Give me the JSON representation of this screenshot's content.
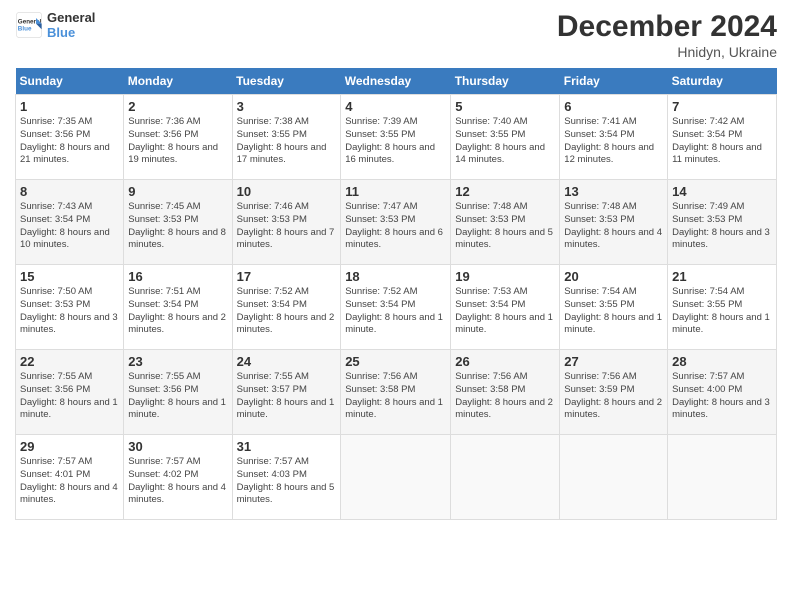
{
  "header": {
    "logo_general": "General",
    "logo_blue": "Blue",
    "month": "December 2024",
    "location": "Hnidyn, Ukraine"
  },
  "days_of_week": [
    "Sunday",
    "Monday",
    "Tuesday",
    "Wednesday",
    "Thursday",
    "Friday",
    "Saturday"
  ],
  "weeks": [
    [
      {
        "day": "1",
        "sunrise": "7:35 AM",
        "sunset": "3:56 PM",
        "daylight": "8 hours and 21 minutes."
      },
      {
        "day": "2",
        "sunrise": "7:36 AM",
        "sunset": "3:56 PM",
        "daylight": "8 hours and 19 minutes."
      },
      {
        "day": "3",
        "sunrise": "7:38 AM",
        "sunset": "3:55 PM",
        "daylight": "8 hours and 17 minutes."
      },
      {
        "day": "4",
        "sunrise": "7:39 AM",
        "sunset": "3:55 PM",
        "daylight": "8 hours and 16 minutes."
      },
      {
        "day": "5",
        "sunrise": "7:40 AM",
        "sunset": "3:55 PM",
        "daylight": "8 hours and 14 minutes."
      },
      {
        "day": "6",
        "sunrise": "7:41 AM",
        "sunset": "3:54 PM",
        "daylight": "8 hours and 12 minutes."
      },
      {
        "day": "7",
        "sunrise": "7:42 AM",
        "sunset": "3:54 PM",
        "daylight": "8 hours and 11 minutes."
      }
    ],
    [
      {
        "day": "8",
        "sunrise": "7:43 AM",
        "sunset": "3:54 PM",
        "daylight": "8 hours and 10 minutes."
      },
      {
        "day": "9",
        "sunrise": "7:45 AM",
        "sunset": "3:53 PM",
        "daylight": "8 hours and 8 minutes."
      },
      {
        "day": "10",
        "sunrise": "7:46 AM",
        "sunset": "3:53 PM",
        "daylight": "8 hours and 7 minutes."
      },
      {
        "day": "11",
        "sunrise": "7:47 AM",
        "sunset": "3:53 PM",
        "daylight": "8 hours and 6 minutes."
      },
      {
        "day": "12",
        "sunrise": "7:48 AM",
        "sunset": "3:53 PM",
        "daylight": "8 hours and 5 minutes."
      },
      {
        "day": "13",
        "sunrise": "7:48 AM",
        "sunset": "3:53 PM",
        "daylight": "8 hours and 4 minutes."
      },
      {
        "day": "14",
        "sunrise": "7:49 AM",
        "sunset": "3:53 PM",
        "daylight": "8 hours and 3 minutes."
      }
    ],
    [
      {
        "day": "15",
        "sunrise": "7:50 AM",
        "sunset": "3:53 PM",
        "daylight": "8 hours and 3 minutes."
      },
      {
        "day": "16",
        "sunrise": "7:51 AM",
        "sunset": "3:54 PM",
        "daylight": "8 hours and 2 minutes."
      },
      {
        "day": "17",
        "sunrise": "7:52 AM",
        "sunset": "3:54 PM",
        "daylight": "8 hours and 2 minutes."
      },
      {
        "day": "18",
        "sunrise": "7:52 AM",
        "sunset": "3:54 PM",
        "daylight": "8 hours and 1 minute."
      },
      {
        "day": "19",
        "sunrise": "7:53 AM",
        "sunset": "3:54 PM",
        "daylight": "8 hours and 1 minute."
      },
      {
        "day": "20",
        "sunrise": "7:54 AM",
        "sunset": "3:55 PM",
        "daylight": "8 hours and 1 minute."
      },
      {
        "day": "21",
        "sunrise": "7:54 AM",
        "sunset": "3:55 PM",
        "daylight": "8 hours and 1 minute."
      }
    ],
    [
      {
        "day": "22",
        "sunrise": "7:55 AM",
        "sunset": "3:56 PM",
        "daylight": "8 hours and 1 minute."
      },
      {
        "day": "23",
        "sunrise": "7:55 AM",
        "sunset": "3:56 PM",
        "daylight": "8 hours and 1 minute."
      },
      {
        "day": "24",
        "sunrise": "7:55 AM",
        "sunset": "3:57 PM",
        "daylight": "8 hours and 1 minute."
      },
      {
        "day": "25",
        "sunrise": "7:56 AM",
        "sunset": "3:58 PM",
        "daylight": "8 hours and 1 minute."
      },
      {
        "day": "26",
        "sunrise": "7:56 AM",
        "sunset": "3:58 PM",
        "daylight": "8 hours and 2 minutes."
      },
      {
        "day": "27",
        "sunrise": "7:56 AM",
        "sunset": "3:59 PM",
        "daylight": "8 hours and 2 minutes."
      },
      {
        "day": "28",
        "sunrise": "7:57 AM",
        "sunset": "4:00 PM",
        "daylight": "8 hours and 3 minutes."
      }
    ],
    [
      {
        "day": "29",
        "sunrise": "7:57 AM",
        "sunset": "4:01 PM",
        "daylight": "8 hours and 4 minutes."
      },
      {
        "day": "30",
        "sunrise": "7:57 AM",
        "sunset": "4:02 PM",
        "daylight": "8 hours and 4 minutes."
      },
      {
        "day": "31",
        "sunrise": "7:57 AM",
        "sunset": "4:03 PM",
        "daylight": "8 hours and 5 minutes."
      },
      null,
      null,
      null,
      null
    ]
  ],
  "labels": {
    "sunrise": "Sunrise:",
    "sunset": "Sunset:",
    "daylight": "Daylight:"
  }
}
